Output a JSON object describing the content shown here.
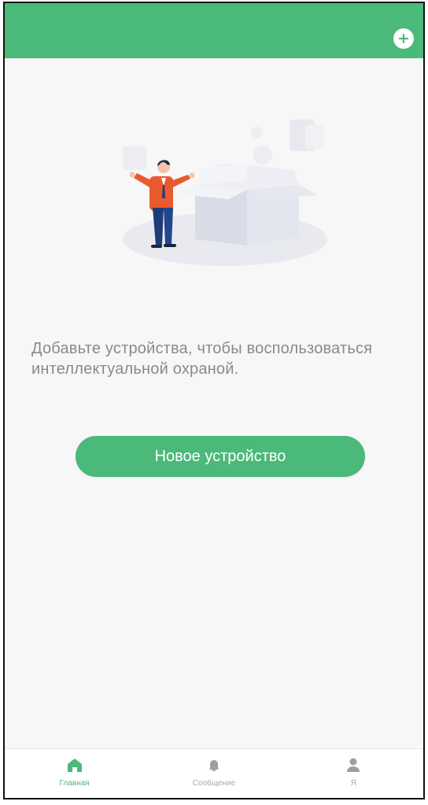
{
  "header": {
    "add_icon": "plus-circle-icon"
  },
  "empty_state": {
    "message": "Добавьте устройства, чтобы воспользоваться интеллектуальной охраной.",
    "button_label": "Новое устройство"
  },
  "tabs": [
    {
      "label": "Главная",
      "icon": "home-icon",
      "active": true
    },
    {
      "label": "Сообщение",
      "icon": "bell-icon",
      "active": false
    },
    {
      "label": "Я",
      "icon": "user-icon",
      "active": false
    }
  ],
  "colors": {
    "accent": "#4bb97a",
    "background": "#f7f7f7",
    "text_muted": "#8a8a8a",
    "inactive_tab": "#a8a8a8"
  }
}
